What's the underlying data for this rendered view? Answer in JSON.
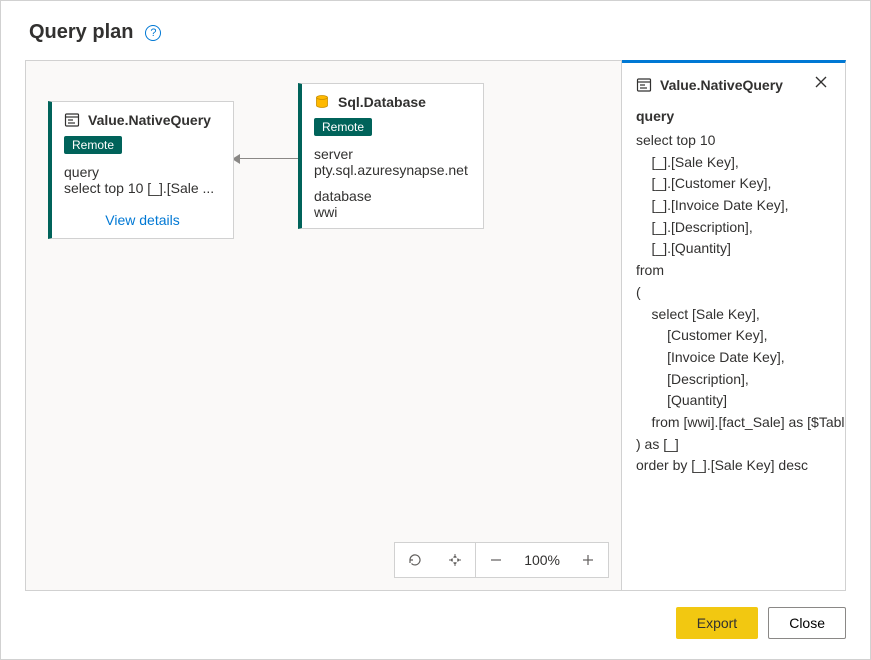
{
  "dialog": {
    "title": "Query plan",
    "help_tooltip": "?"
  },
  "canvas": {
    "nodes": [
      {
        "id": "native-query",
        "icon": "query-icon",
        "title": "Value.NativeQuery",
        "badge": "Remote",
        "fields": [
          {
            "label": "query",
            "value": "select top 10 [_].[Sale ..."
          }
        ],
        "link": "View details"
      },
      {
        "id": "sql-database",
        "icon": "database-icon",
        "title": "Sql.Database",
        "badge": "Remote",
        "fields": [
          {
            "label": "server",
            "value": "pty.sql.azuresynapse.net"
          },
          {
            "label": "database",
            "value": "wwi"
          }
        ]
      }
    ],
    "zoom": {
      "level": "100%"
    }
  },
  "details": {
    "icon": "query-icon",
    "title": "Value.NativeQuery",
    "label": "query",
    "body": "select top 10\n    [_].[Sale Key],\n    [_].[Customer Key],\n    [_].[Invoice Date Key],\n    [_].[Description],\n    [_].[Quantity]\nfrom\n(\n    select [Sale Key],\n        [Customer Key],\n        [Invoice Date Key],\n        [Description],\n        [Quantity]\n    from [wwi].[fact_Sale] as [$Table]\n) as [_]\norder by [_].[Sale Key] desc"
  },
  "footer": {
    "export": "Export",
    "close": "Close"
  }
}
